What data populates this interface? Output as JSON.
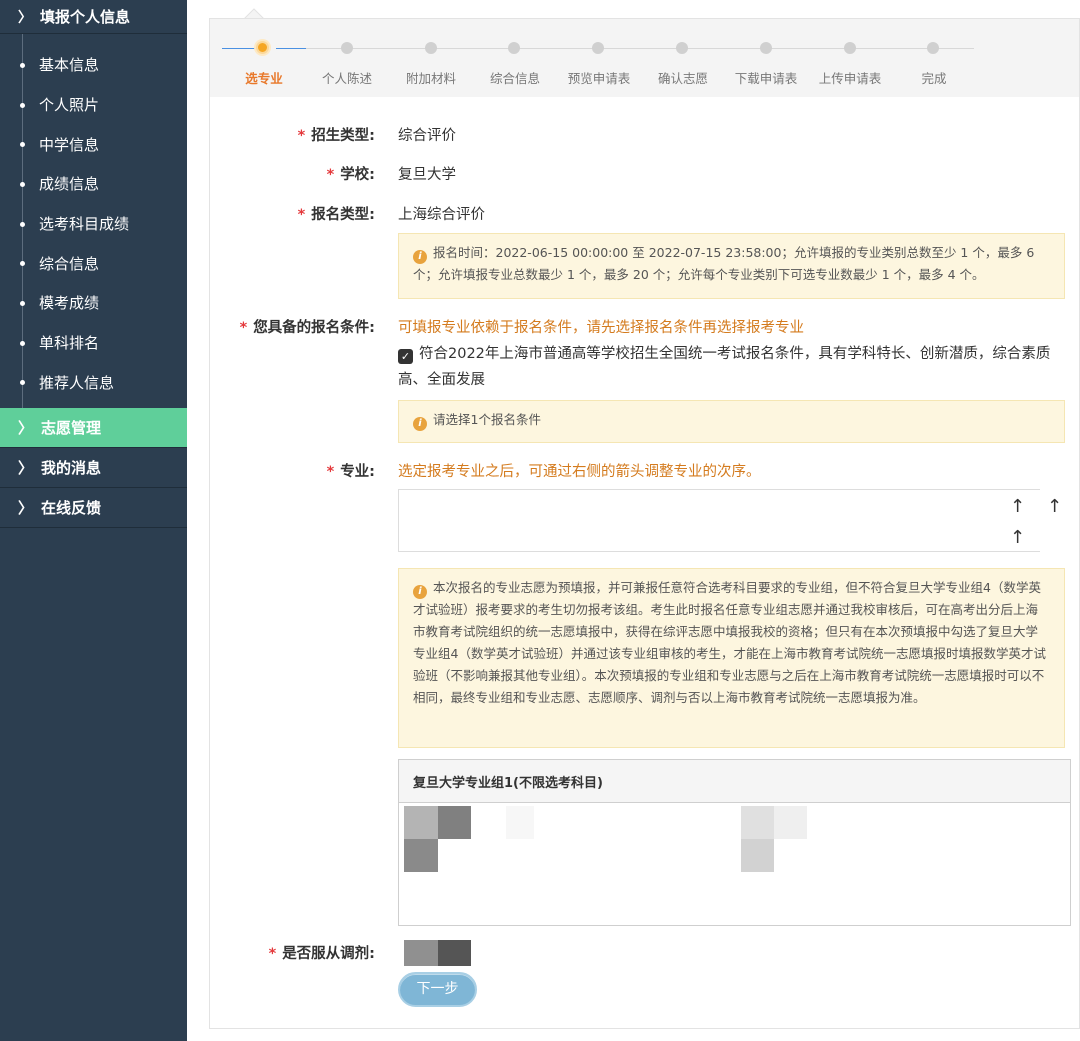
{
  "sidebar": {
    "header": "填报个人信息",
    "sub_items": [
      "基本信息",
      "个人照片",
      "中学信息",
      "成绩信息",
      "选考科目成绩",
      "综合信息",
      "模考成绩",
      "单科排名",
      "推荐人信息"
    ],
    "menu": [
      {
        "label": "志愿管理",
        "active": true
      },
      {
        "label": "我的消息",
        "active": false
      },
      {
        "label": "在线反馈",
        "active": false
      }
    ]
  },
  "steps": [
    "选专业",
    "个人陈述",
    "附加材料",
    "综合信息",
    "预览申请表",
    "确认志愿",
    "下载申请表",
    "上传申请表",
    "完成"
  ],
  "active_step": 0,
  "form": {
    "type_label": "招生类型:",
    "type_value": "综合评价",
    "school_label": "学校:",
    "school_value": "复旦大学",
    "reg_type_label": "报名类型:",
    "reg_type_value": "上海综合评价",
    "notice1": "报名时间：2022-06-15 00:00:00 至 2022-07-15 23:58:00；允许填报的专业类别总数至少 1 个，最多 6 个；允许填报专业总数最少 1 个，最多 20 个；允许每个专业类别下可选专业数最少 1 个，最多 4 个。",
    "cond_label": "您具备的报名条件:",
    "cond_hint": "可填报专业依赖于报名条件，请先选择报名条件再选择报考专业",
    "cond_check": "符合2022年上海市普通高等学校招生全国统一考试报名条件，具有学科特长、创新潜质，综合素质高、全面发展",
    "notice2": "请选择1个报名条件",
    "major_label": "专业:",
    "major_hint": "选定报考专业之后，可通过右侧的箭头调整专业的次序。",
    "notice3": "本次报名的专业志愿为预填报，并可兼报任意符合选考科目要求的专业组，但不符合复旦大学专业组4（数学英才试验班）报考要求的考生切勿报考该组。考生此时报名任意专业组志愿并通过我校审核后，可在高考出分后上海市教育考试院组织的统一志愿填报中，获得在综评志愿中填报我校的资格；但只有在本次预填报中勾选了复旦大学专业组4（数学英才试验班）并通过该专业组审核的考生，才能在上海市教育考试院统一志愿填报时填报数学英才试验班（不影响兼报其他专业组）。本次预填报的专业组和专业志愿与之后在上海市教育考试院统一志愿填报时可以不相同，最终专业组和专业志愿、志愿顺序、调剂与否以上海市教育考试院统一志愿填报为准。",
    "group_header": "复旦大学专业组1(不限选考科目)",
    "adjust_label": "是否服从调剂:",
    "next_button": "下一步",
    "arrow_symbol": "↑"
  },
  "colors": {
    "sidebar_bg": "#2c3e50",
    "active_menu": "#5fcf9a",
    "active_step": "#f5a623",
    "hint_text": "#d47b1e",
    "notice_bg": "#fdf6df",
    "required": "#e4393c"
  }
}
